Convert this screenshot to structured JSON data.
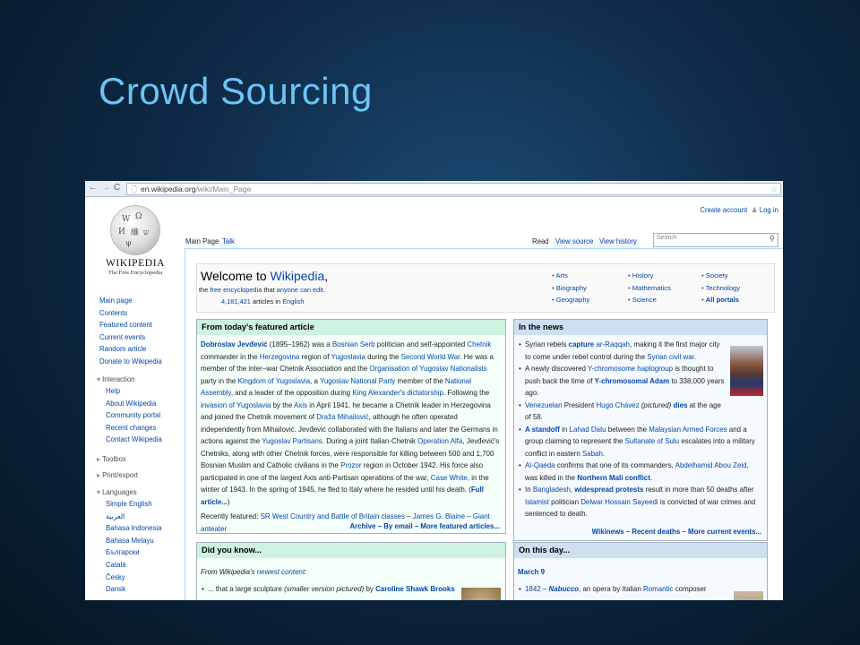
{
  "slide": {
    "title": "Crowd Sourcing"
  },
  "browser": {
    "back": "←",
    "forward": "→",
    "reload": "C",
    "url_host": "en.wikipedia.org",
    "url_path": "/wiki/Main_Page",
    "star": "☆",
    "page_icon": "🗋"
  },
  "logo": {
    "wordmark": "WIKIPEDIA",
    "tagline": "The Free Encyclopedia"
  },
  "sidebar": {
    "nav": [
      "Main page",
      "Contents",
      "Featured content",
      "Current events",
      "Random article",
      "Donate to Wikipedia"
    ],
    "interaction_heading": "Interaction",
    "interaction": [
      "Help",
      "About Wikipedia",
      "Community portal",
      "Recent changes",
      "Contact Wikipedia"
    ],
    "toolbox": "Toolbox",
    "print_export": "Print/export",
    "languages_heading": "Languages",
    "languages": [
      "Simple English",
      "العربية",
      "Bahasa Indonesia",
      "Bahasa Melayu",
      "Български",
      "Català",
      "Česky",
      "Dansk"
    ]
  },
  "personal": {
    "create_account": "Create account",
    "log_in": "Log in"
  },
  "tabs": {
    "main_page": "Main Page",
    "talk": "Talk",
    "read": "Read",
    "view_source": "View source",
    "view_history": "View history"
  },
  "search": {
    "placeholder": "Search"
  },
  "welcome": {
    "title_prefix": "Welcome to ",
    "title_link": "Wikipedia",
    "title_suffix": ",",
    "sub_the": "the",
    "sub_free": "free",
    "sub_encyclopedia": "encyclopedia",
    "sub_that": "that",
    "sub_anyone": "anyone can edit",
    "sub_end": ".",
    "count": "4,181,421",
    "count_text": "articles in",
    "count_lang": "English"
  },
  "portals": [
    [
      "Arts",
      "Biography",
      "Geography"
    ],
    [
      "History",
      "Mathematics",
      "Science"
    ],
    [
      "Society",
      "Technology",
      "All portals"
    ]
  ],
  "featured": {
    "heading": "From today's featured article",
    "text_html": "<b><a>Dobroslav Jevđević</a></b> (1895–1962) was a <a>Bosnian Serb</a> politician and self-appointed <a>Chetnik</a> commander in the <a>Herzegovina</a> region of <a>Yugoslavia</a> during the <a>Second World War</a>. He was a member of the inter–war Chetnik Association and the <a>Organisation of Yugoslav Nationalists</a> party in the <a>Kingdom of Yugoslavia</a>, a <a>Yugoslav National Party</a> member of the <a>National Assembly</a>, and a leader of the opposition during <a>King Alexander's dictatorship</a>. Following the <a>invasion of Yugoslavia</a> by the <a>Axis</a> in April 1941, he became a Chetnik leader in Herzegovina and joined the Chetnik movement of <a>Draža Mihailović</a>, although he often operated independently from Mihailović. Jevđević collaborated with the Italians and later the Germans in actions against the <a>Yugoslav Partisans</a>. During a joint Italian-Chetnik <a>Operation Alfa</a>, Jevđević's Chetniks, along with other Chetnik forces, were responsible for killing between 500 and 1,700 Bosnian Muslim and Catholic civilians in the <a>Prozor</a> region in October 1942. His force also participated in one of the largest Axis anti-Partisan operations of the war, <a>Case White</a>, in the winter of 1943. In the spring of 1945, he fled to Italy where he resided until his death. (<b><a>Full article...</a></b>)",
    "recent_html": "Recently featured: <a>SR West Country and Battle of Britain classes</a> – <a>James G. Blaine</a> – <a>Giant anteater</a>",
    "footer": "Archive – By email – More featured articles..."
  },
  "news": {
    "heading": "In the news",
    "items_html": [
      "Syrian rebels <b><a>capture</a></b> <a>ar-Raqqah</a>, making it the first major city to come under rebel control during the <a>Syrian civil war</a>.",
      "A newly discovered <a>Y-chromosome haplogroup</a> is thought to push back the time of <b><a>Y-chromosomal Adam</a></b> to 338,000 years ago.",
      "<a>Venezuelan</a> President <a>Hugo Chávez</a> <i>(pictured)</i> <b><a>dies</a></b> at the age of 58.",
      "<b><a>A standoff</a></b> in <a>Lahad Datu</a> between the <a>Malaysian Armed Forces</a> and a group claiming to represent the <a>Sultanate of Sulu</a> escalates into a military conflict in eastern <a>Sabah</a>.",
      "<a>Al-Qaeda</a> confirms that one of its commanders, <a>Abdelhamid Abou Zeid</a>, was killed in the <b><a>Northern Mali conflict</a></b>.",
      "In <a>Bangladesh</a>, <b><a>widespread protests</a></b> result in more than 50 deaths after <a>Islamist</a> politician <a>Delwar Hossain Sayeedi</a> is convicted of war crimes and sentenced to death."
    ],
    "footer": "Wikinews – Recent deaths – More current events..."
  },
  "dyk": {
    "heading": "Did you know...",
    "intro_html": "<i>From Wikipedia's <a>newest content</a>:</i>",
    "item_html": "... that a large sculpture <i>(smaller version pictured)</i> by <b><a>Caroline Shawk Brooks</a></b>"
  },
  "otd": {
    "heading": "On this day...",
    "date": "March 9",
    "item_html": "<a>1842</a> – <b><i><a>Nabucco</a></i></b>, an opera by Italian <a>Romantic</a> composer"
  },
  "colors": {
    "featured_head": "#cef2e0",
    "featured_bg": "#f5fffa",
    "news_head": "#cedff2",
    "news_bg": "#f5faff",
    "link": "#0645ad",
    "title": "#6cc4f4"
  }
}
